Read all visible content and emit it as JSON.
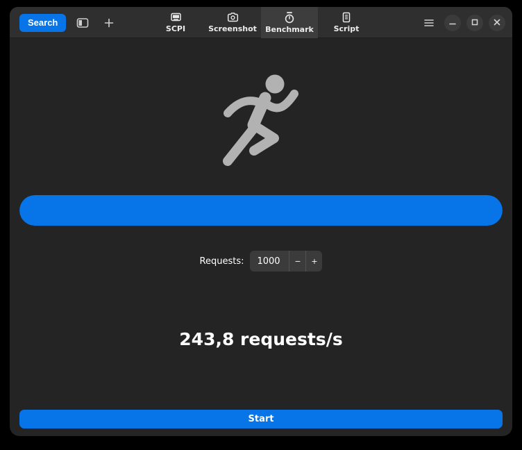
{
  "header": {
    "search_label": "Search",
    "icons": {
      "sidebar_toggle": "sidebar-toggle-icon",
      "new_tab": "plus-icon",
      "menu": "hamburger-menu-icon",
      "minimize": "minimize-icon",
      "maximize": "maximize-icon",
      "close": "close-icon"
    },
    "tabs": [
      {
        "label": "SCPI",
        "icon": "display-icon",
        "active": false
      },
      {
        "label": "Screenshot",
        "icon": "camera-icon",
        "active": false
      },
      {
        "label": "Benchmark",
        "icon": "stopwatch-icon",
        "active": true
      },
      {
        "label": "Script",
        "icon": "document-icon",
        "active": false
      }
    ]
  },
  "benchmark": {
    "runner_icon": "running-person-icon",
    "progress_percent": 100,
    "requests_label": "Requests:",
    "requests_value": "1000",
    "decrement_label": "−",
    "increment_label": "+",
    "result_text": "243,8 requests/s",
    "start_label": "Start"
  },
  "colors": {
    "accent": "#0774e8",
    "window_bg": "#242424",
    "header_bg": "#2f2f2f",
    "active_tab_bg": "#3d3d3d",
    "icon_gray": "#b2b2b2"
  }
}
